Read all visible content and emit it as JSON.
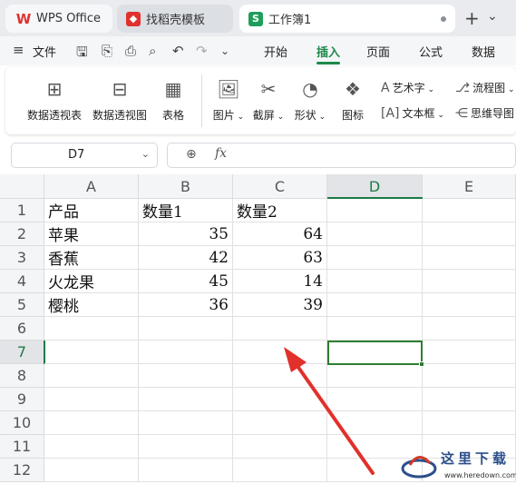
{
  "tabs": [
    {
      "label": "WPS Office",
      "icon": "wps-logo-icon"
    },
    {
      "label": "找稻壳模板",
      "icon": "docer-icon"
    },
    {
      "label": "工作簿1",
      "icon": "sheet-icon",
      "badge": "S"
    }
  ],
  "menu": {
    "file": "文件",
    "items": [
      "开始",
      "插入",
      "页面",
      "公式",
      "数据"
    ],
    "active": "插入"
  },
  "ribbon": {
    "pivot_table": "数据透视表",
    "pivot_chart": "数据透视图",
    "table": "表格",
    "picture": "图片",
    "screenshot": "截屏",
    "shape": "形状",
    "icon": "图标",
    "art_text": "艺术字",
    "text_box": "文本框",
    "flowchart": "流程图",
    "mindmap": "思维导图"
  },
  "formula_bar": {
    "name_box": "D7",
    "fx": "fx",
    "content": ""
  },
  "grid": {
    "columns": [
      "A",
      "B",
      "C",
      "D",
      "E"
    ],
    "rows": [
      "1",
      "2",
      "3",
      "4",
      "5",
      "6",
      "7",
      "8",
      "9",
      "10",
      "11",
      "12"
    ],
    "active_cell": "D7",
    "data": [
      [
        "产品",
        "数量1",
        "数量2"
      ],
      [
        "苹果",
        "35",
        "64"
      ],
      [
        "香蕉",
        "42",
        "63"
      ],
      [
        "火龙果",
        "45",
        "14"
      ],
      [
        "樱桃",
        "36",
        "39"
      ]
    ]
  },
  "annotation": {
    "color": "#e2302a"
  },
  "watermark": {
    "title": "这里下载",
    "url": "www.heredown.com"
  },
  "colors": {
    "accent": "#1e8a4c",
    "selection": "#2e7d32",
    "wps_red": "#e0312f"
  }
}
